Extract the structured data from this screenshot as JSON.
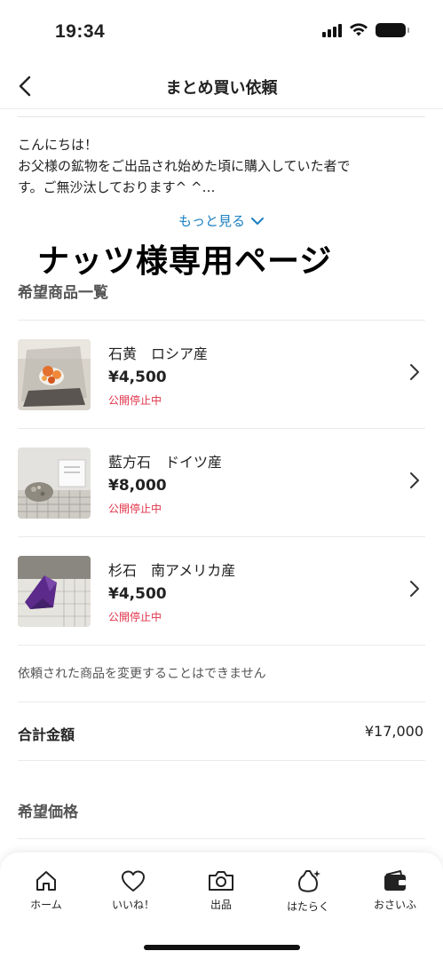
{
  "status_bar": {
    "time": "19:34"
  },
  "header": {
    "title": "まとめ買い依頼"
  },
  "message": {
    "line1": "こんにちは！",
    "line2": "お父様の鉱物をご出品され始めた頃に購入していた者で",
    "line3": "す。ご無沙汰しております^ ^…",
    "more_label": "もっと見る"
  },
  "overlay_title": "ナッツ様専用ページ",
  "wishlist": {
    "title": "希望商品一覧",
    "items": [
      {
        "name": "石黄　ロシア産",
        "price": "¥4,500",
        "status": "公開停止中",
        "thumb_icon": "orpiment-photo"
      },
      {
        "name": "藍方石　ドイツ産",
        "price": "¥8,000",
        "status": "公開停止中",
        "thumb_icon": "hauyne-photo"
      },
      {
        "name": "杉石　南アメリカ産",
        "price": "¥4,500",
        "status": "公開停止中",
        "thumb_icon": "sugilite-photo"
      }
    ]
  },
  "note": "依頼された商品を変更することはできません",
  "total": {
    "label": "合計金額",
    "value": "¥17,000"
  },
  "hope_price": {
    "label": "希望価格"
  },
  "tab_bar": {
    "tabs": [
      {
        "label": "ホーム",
        "icon": "home-icon"
      },
      {
        "label": "いいね！",
        "icon": "heart-icon"
      },
      {
        "label": "出品",
        "icon": "camera-icon"
      },
      {
        "label": "はたらく",
        "icon": "work-bag-icon"
      },
      {
        "label": "おさいふ",
        "icon": "wallet-icon"
      }
    ]
  },
  "colors": {
    "link": "#1a7fc1",
    "status_red": "#e0334a"
  }
}
